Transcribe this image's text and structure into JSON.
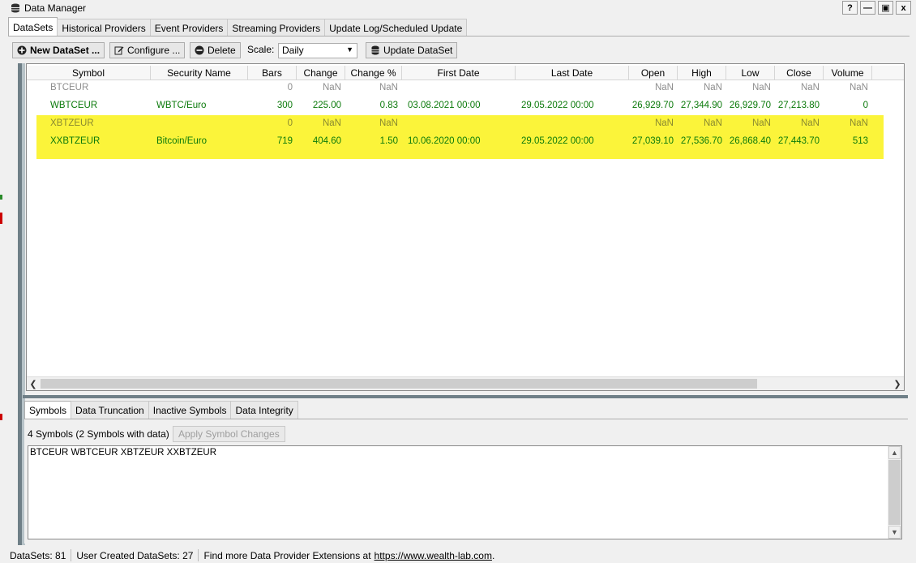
{
  "window": {
    "title": "Data Manager",
    "buttons": [
      "?",
      "—",
      "▣",
      "x"
    ]
  },
  "main_tabs": [
    {
      "label": "DataSets",
      "active": true
    },
    {
      "label": "Historical Providers",
      "active": false
    },
    {
      "label": "Event Providers",
      "active": false
    },
    {
      "label": "Streaming Providers",
      "active": false
    },
    {
      "label": "Update Log/Scheduled Update",
      "active": false
    }
  ],
  "toolbar": {
    "new_dataset": "New DataSet ...",
    "configure": "Configure ...",
    "delete": "Delete",
    "scale_label": "Scale:",
    "scale_value": "Daily",
    "update_dataset": "Update DataSet"
  },
  "grid": {
    "columns": [
      "Symbol",
      "Security Name",
      "Bars",
      "Change",
      "Change %",
      "First Date",
      "Last Date",
      "Open",
      "High",
      "Low",
      "Close",
      "Volume"
    ],
    "rows": [
      {
        "symbol": "BTCEUR",
        "name": "",
        "bars": "0",
        "change": "NaN",
        "change_pct": "NaN",
        "first": "",
        "last": "",
        "open": "NaN",
        "high": "NaN",
        "low": "NaN",
        "close": "NaN",
        "volume": "NaN",
        "style": "grey",
        "highlight": false
      },
      {
        "symbol": "WBTCEUR",
        "name": "WBTC/Euro",
        "bars": "300",
        "change": "225.00",
        "change_pct": "0.83",
        "first": "03.08.2021 00:00",
        "last": "29.05.2022 00:00",
        "open": "26,929.70",
        "high": "27,344.90",
        "low": "26,929.70",
        "close": "27,213.80",
        "volume": "0",
        "style": "green",
        "highlight": false
      },
      {
        "symbol": "XBTZEUR",
        "name": "",
        "bars": "0",
        "change": "NaN",
        "change_pct": "NaN",
        "first": "",
        "last": "",
        "open": "NaN",
        "high": "NaN",
        "low": "NaN",
        "close": "NaN",
        "volume": "NaN",
        "style": "grey",
        "highlight": true
      },
      {
        "symbol": "XXBTZEUR",
        "name": "Bitcoin/Euro",
        "bars": "719",
        "change": "404.60",
        "change_pct": "1.50",
        "first": "10.06.2020 00:00",
        "last": "29.05.2022 00:00",
        "open": "27,039.10",
        "high": "27,536.70",
        "low": "26,868.40",
        "close": "27,443.70",
        "volume": "513",
        "style": "green",
        "highlight": true
      }
    ]
  },
  "bottom_tabs": [
    {
      "label": "Symbols",
      "active": true
    },
    {
      "label": "Data Truncation",
      "active": false
    },
    {
      "label": "Inactive Symbols",
      "active": false
    },
    {
      "label": "Data Integrity",
      "active": false
    }
  ],
  "symbols_panel": {
    "count_text": "4 Symbols (2 Symbols with data)",
    "apply_button": "Apply Symbol Changes",
    "symbols_text": "BTCEUR WBTCEUR XBTZEUR XXBTZEUR"
  },
  "statusbar": {
    "datasets": "DataSets: 81",
    "user_created": "User Created DataSets: 27",
    "find_more": "Find more Data Provider Extensions at",
    "link": "https://www.wealth-lab.com",
    "link_suffix": "."
  },
  "colors": {
    "highlight": "#fbf43a",
    "data_green": "#0b7a0b",
    "empty_grey": "#8e8e8e",
    "splitter": "#6f7f87"
  }
}
